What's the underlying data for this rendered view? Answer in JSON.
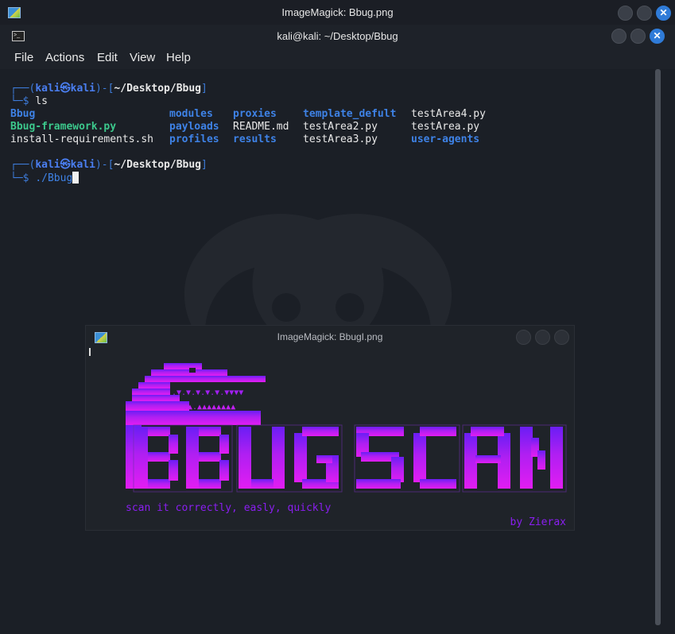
{
  "outer_window": {
    "title": "ImageMagick: Bbug.png"
  },
  "terminal": {
    "title": "kali@kali: ~/Desktop/Bbug",
    "menu": [
      "File",
      "Actions",
      "Edit",
      "View",
      "Help"
    ],
    "prompt1": {
      "open": "┌──(",
      "user": "kali㉿kali",
      "mid": ")-[",
      "path": "~/Desktop/Bbug",
      "close": "]",
      "dollar": "└─$ ",
      "command": "ls"
    },
    "ls_output": {
      "col1": [
        "Bbug",
        "Bbug-framework.py",
        "install-requirements.sh"
      ],
      "col2": [
        "modules",
        "payloads",
        "profiles"
      ],
      "col3": [
        "proxies",
        "README.md",
        "results"
      ],
      "col4": [
        "template_defult",
        "testArea2.py",
        "testArea3.py"
      ],
      "col5": [
        "testArea4.py",
        "testArea.py",
        "user-agents"
      ]
    },
    "prompt2": {
      "open": "┌──(",
      "user": "kali㉿kali",
      "mid": ")-[",
      "path": "~/Desktop/Bbug",
      "close": "]",
      "dollar": "└─$ ",
      "command": "./Bbug"
    }
  },
  "inner_window": {
    "title": "ImageMagick: BbugI.png",
    "tagline": "scan it correctly, easly, quickly",
    "author": "by Zierax"
  },
  "colors": {
    "banner_top": "#6a1ef5",
    "banner_bottom": "#e21df2",
    "accent_blue": "#3e82e6",
    "accent_green": "#3cc88c"
  }
}
